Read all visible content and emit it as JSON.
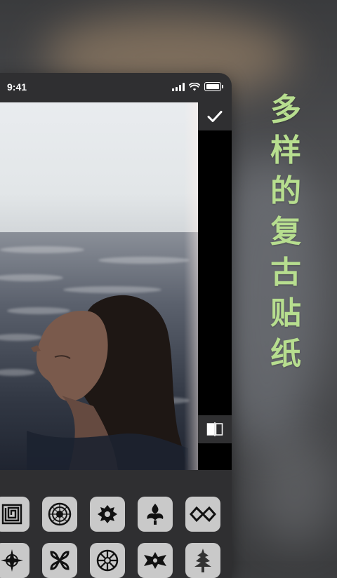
{
  "status_bar": {
    "time": "9:41"
  },
  "slogan": {
    "chars": [
      "多",
      "样",
      "的",
      "复",
      "古",
      "贴",
      "纸"
    ]
  },
  "toolbar": {
    "confirm_icon": "checkmark-icon",
    "compare_icon": "compare-split-icon"
  },
  "colors": {
    "slogan": "#b7de8f",
    "panel": "#2f2f31",
    "tile": "#c9c9c9"
  },
  "stickers": {
    "row1": [
      "geometric-maze-sticker",
      "circular-mandala-sticker",
      "ornate-crest-sticker",
      "fleur-ornament-sticker",
      "knot-pattern-sticker"
    ],
    "row2": [
      "compass-star-sticker",
      "cross-knot-sticker",
      "round-mandala-sticker",
      "scroll-ornament-sticker",
      "tree-ornament-sticker"
    ]
  }
}
